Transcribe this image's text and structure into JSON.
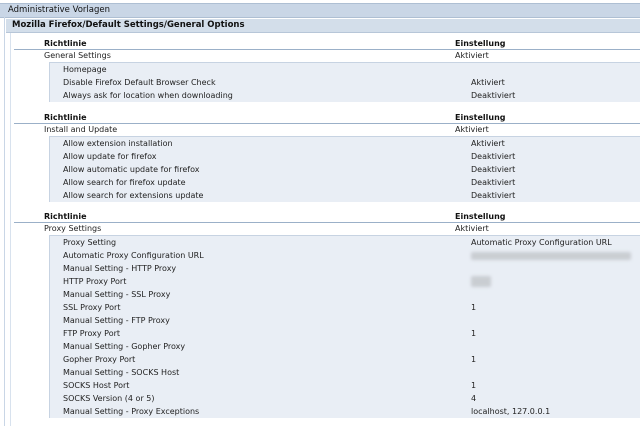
{
  "header": {
    "title": "Administrative Vorlagen",
    "subtitle": "Mozilla Firefox/Default Settings/General Options"
  },
  "columns": {
    "policy": "Richtlinie",
    "setting": "Einstellung"
  },
  "sections": [
    {
      "category": {
        "name": "General Settings",
        "value": "Aktiviert"
      },
      "rows": [
        {
          "name": "Homepage",
          "value": ""
        },
        {
          "name": "Disable Firefox Default Browser Check",
          "value": "Aktiviert"
        },
        {
          "name": "Always ask for location when downloading",
          "value": "Deaktiviert"
        }
      ]
    },
    {
      "category": {
        "name": "Install and Update",
        "value": "Aktiviert"
      },
      "rows": [
        {
          "name": "Allow extension installation",
          "value": "Aktiviert"
        },
        {
          "name": "Allow update for firefox",
          "value": "Deaktiviert"
        },
        {
          "name": "Allow automatic update for firefox",
          "value": "Deaktiviert"
        },
        {
          "name": "Allow search for firefox update",
          "value": "Deaktiviert"
        },
        {
          "name": "Allow search for extensions update",
          "value": "Deaktiviert"
        }
      ]
    },
    {
      "category": {
        "name": "Proxy Settings",
        "value": "Aktiviert"
      },
      "rows": [
        {
          "name": "Proxy Setting",
          "value": "Automatic Proxy Configuration URL"
        },
        {
          "name": "Automatic Proxy Configuration URL",
          "value": ""
        },
        {
          "name": "Manual Setting - HTTP Proxy",
          "value": ""
        },
        {
          "name": "HTTP Proxy Port",
          "value": ""
        },
        {
          "name": "Manual Setting - SSL Proxy",
          "value": ""
        },
        {
          "name": "SSL Proxy Port",
          "value": "1"
        },
        {
          "name": "Manual Setting - FTP Proxy",
          "value": ""
        },
        {
          "name": "FTP Proxy Port",
          "value": "1"
        },
        {
          "name": "Manual Setting - Gopher Proxy",
          "value": ""
        },
        {
          "name": "Gopher Proxy Port",
          "value": "1"
        },
        {
          "name": "Manual Setting - SOCKS Host",
          "value": ""
        },
        {
          "name": "SOCKS Host Port",
          "value": "1"
        },
        {
          "name": "SOCKS Version (4 or 5)",
          "value": "4"
        },
        {
          "name": "Manual Setting - Proxy Exceptions",
          "value": "localhost, 127.0.0.1"
        }
      ]
    }
  ]
}
